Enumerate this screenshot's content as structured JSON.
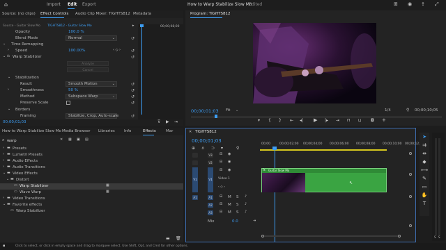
{
  "topbar": {
    "nav": [
      "Import",
      "Edit",
      "Export"
    ],
    "project_title": "How to Warp Stabilize Slow Mo",
    "edited": "- Edited"
  },
  "source_panel": {
    "tabs": [
      "Source: (no clips)",
      "Effect Controls",
      "Audio Clip Mixer: TIGHTS812",
      "Metadata"
    ],
    "header_source": "Source - Guitar Slow Mo",
    "header_clip": "TIGHTS812 - Guitar Slow Mo",
    "ruler_time": "00;00;08;00",
    "rows": {
      "opacity_label": "Opacity",
      "opacity_value": "100.0 %",
      "blend_label": "Blend Mode",
      "blend_value": "Normal",
      "time_remap_label": "Time Remapping",
      "speed_label": "Speed",
      "speed_value": "100.00%",
      "warp_label": "Warp Stabilizer",
      "analyze_label": "Analyze",
      "cancel_label": "Cancel",
      "stabilization_label": "Stabilization",
      "result_label": "Result",
      "result_value": "Smooth Motion",
      "smoothness_label": "Smoothness",
      "smoothness_value": "50 %",
      "method_label": "Method",
      "method_value": "Subspace Warp",
      "preserve_label": "Preserve Scale",
      "borders_label": "Borders",
      "framing_label": "Framing",
      "framing_value": "Stabilize, Crop, Auto-scale"
    },
    "timecode": "00;00;01;03"
  },
  "program_panel": {
    "title": "Program: TIGHTS812",
    "timecode": "00;00;01;03",
    "fit": "Fit",
    "page": "1/4",
    "duration": "00;00;10;05"
  },
  "project_panel": {
    "tabs": [
      "How to Warp Stabilize Slow Mo",
      "Media Browser",
      "Libraries",
      "Info",
      "Effects",
      "Mar"
    ],
    "search_value": "warp",
    "tree": [
      {
        "label": "Presets",
        "indent": 0,
        "type": "folder"
      },
      {
        "label": "Lumetri Presets",
        "indent": 0,
        "type": "folder"
      },
      {
        "label": "Audio Effects",
        "indent": 0,
        "type": "folder"
      },
      {
        "label": "Audio Transitions",
        "indent": 0,
        "type": "folder"
      },
      {
        "label": "Video Effects",
        "indent": 0,
        "type": "folder-open"
      },
      {
        "label": "Distort",
        "indent": 1,
        "type": "folder-open"
      },
      {
        "label": "Warp Stabilizer",
        "indent": 2,
        "type": "effect",
        "selected": true
      },
      {
        "label": "Wave Warp",
        "indent": 2,
        "type": "effect"
      },
      {
        "label": "Video Transitions",
        "indent": 0,
        "type": "folder"
      },
      {
        "label": "Favorite effects",
        "indent": 0,
        "type": "folder-open"
      },
      {
        "label": "Warp Stabilizer",
        "indent": 1,
        "type": "effect"
      }
    ]
  },
  "timeline": {
    "title": "TIGHTS812",
    "timecode": "00;00;01;03",
    "ruler": [
      "00;00",
      "00;00;02;00",
      "00;00;04;00",
      "00;00;06;00",
      "00;00;08;00",
      "00;00;10;00",
      "00;00;12;00"
    ],
    "tracks_video": [
      "V3",
      "V2",
      "V1"
    ],
    "tracks_audio": [
      "A1",
      "A2",
      "A3"
    ],
    "video1_label": "Video 1",
    "clip_label": "Guitar Slow Mo",
    "mix_label": "Mix",
    "mix_value": "0.0",
    "track_btn_m": "M",
    "track_btn_s": "S"
  },
  "status_bar": {
    "text": "Click to select, or click in empty space and drag to marquee select. Use Shift, Opt, and Cmd for other options."
  },
  "colors": {
    "accent": "#3d9df3",
    "clip_green": "#3aa442",
    "track_blue": "#2b4a72"
  }
}
